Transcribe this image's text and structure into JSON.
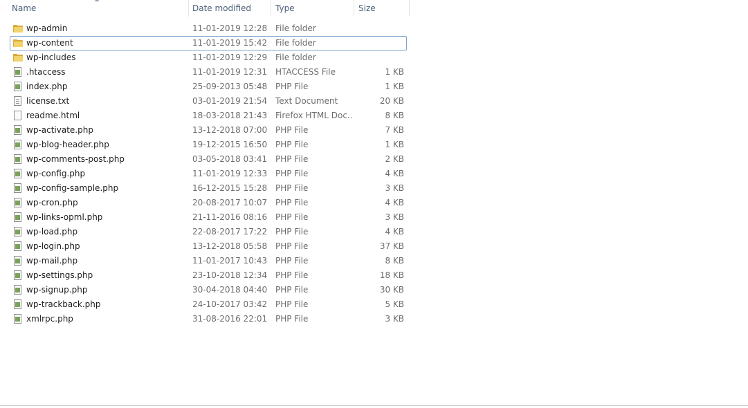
{
  "columns": {
    "name": "Name",
    "date": "Date modified",
    "type": "Type",
    "size": "Size"
  },
  "selected_item": "wp-content",
  "files": [
    {
      "name": "wp-admin",
      "date": "11-01-2019 12:28",
      "type": "File folder",
      "size": "",
      "icon": "folder-icon"
    },
    {
      "name": "wp-content",
      "date": "11-01-2019 15:42",
      "type": "File folder",
      "size": "",
      "icon": "folder-icon"
    },
    {
      "name": "wp-includes",
      "date": "11-01-2019 12:29",
      "type": "File folder",
      "size": "",
      "icon": "folder-icon"
    },
    {
      "name": ".htaccess",
      "date": "11-01-2019 12:31",
      "type": "HTACCESS File",
      "size": "1 KB",
      "icon": "php-file-icon"
    },
    {
      "name": "index.php",
      "date": "25-09-2013 05:48",
      "type": "PHP File",
      "size": "1 KB",
      "icon": "php-file-icon"
    },
    {
      "name": "license.txt",
      "date": "03-01-2019 21:54",
      "type": "Text Document",
      "size": "20 KB",
      "icon": "text-file-icon"
    },
    {
      "name": "readme.html",
      "date": "18-03-2018 21:43",
      "type": "Firefox HTML Doc...",
      "size": "8 KB",
      "icon": "blank-file-icon"
    },
    {
      "name": "wp-activate.php",
      "date": "13-12-2018 07:00",
      "type": "PHP File",
      "size": "7 KB",
      "icon": "php-file-icon"
    },
    {
      "name": "wp-blog-header.php",
      "date": "19-12-2015 16:50",
      "type": "PHP File",
      "size": "1 KB",
      "icon": "php-file-icon"
    },
    {
      "name": "wp-comments-post.php",
      "date": "03-05-2018 03:41",
      "type": "PHP File",
      "size": "2 KB",
      "icon": "php-file-icon"
    },
    {
      "name": "wp-config.php",
      "date": "11-01-2019 12:33",
      "type": "PHP File",
      "size": "4 KB",
      "icon": "php-file-icon"
    },
    {
      "name": "wp-config-sample.php",
      "date": "16-12-2015 15:28",
      "type": "PHP File",
      "size": "3 KB",
      "icon": "php-file-icon"
    },
    {
      "name": "wp-cron.php",
      "date": "20-08-2017 10:07",
      "type": "PHP File",
      "size": "4 KB",
      "icon": "php-file-icon"
    },
    {
      "name": "wp-links-opml.php",
      "date": "21-11-2016 08:16",
      "type": "PHP File",
      "size": "3 KB",
      "icon": "php-file-icon"
    },
    {
      "name": "wp-load.php",
      "date": "22-08-2017 17:22",
      "type": "PHP File",
      "size": "4 KB",
      "icon": "php-file-icon"
    },
    {
      "name": "wp-login.php",
      "date": "13-12-2018 05:58",
      "type": "PHP File",
      "size": "37 KB",
      "icon": "php-file-icon"
    },
    {
      "name": "wp-mail.php",
      "date": "11-01-2017 10:43",
      "type": "PHP File",
      "size": "8 KB",
      "icon": "php-file-icon"
    },
    {
      "name": "wp-settings.php",
      "date": "23-10-2018 12:34",
      "type": "PHP File",
      "size": "18 KB",
      "icon": "php-file-icon"
    },
    {
      "name": "wp-signup.php",
      "date": "30-04-2018 04:40",
      "type": "PHP File",
      "size": "30 KB",
      "icon": "php-file-icon"
    },
    {
      "name": "wp-trackback.php",
      "date": "24-10-2017 03:42",
      "type": "PHP File",
      "size": "5 KB",
      "icon": "php-file-icon"
    },
    {
      "name": "xmlrpc.php",
      "date": "31-08-2016 22:01",
      "type": "PHP File",
      "size": "3 KB",
      "icon": "php-file-icon"
    }
  ]
}
